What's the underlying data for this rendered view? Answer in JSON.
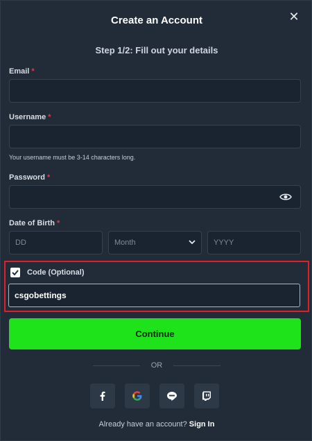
{
  "header": {
    "title": "Create an Account",
    "step": "Step 1/2: Fill out your details"
  },
  "form": {
    "email": {
      "label": "Email",
      "required_mark": "*",
      "value": ""
    },
    "username": {
      "label": "Username",
      "required_mark": "*",
      "value": "",
      "hint": "Your username must be 3-14 characters long."
    },
    "password": {
      "label": "Password",
      "required_mark": "*",
      "value": ""
    },
    "dob": {
      "label": "Date of Birth",
      "required_mark": "*",
      "day_placeholder": "DD",
      "month_placeholder": "Month",
      "year_placeholder": "YYYY"
    },
    "code": {
      "label": "Code (Optional)",
      "checked": true,
      "value": "csgobettings"
    }
  },
  "actions": {
    "continue_label": "Continue",
    "or_label": "OR"
  },
  "social": {
    "buttons": [
      {
        "name": "facebook",
        "icon": "facebook-icon"
      },
      {
        "name": "google",
        "icon": "google-icon"
      },
      {
        "name": "line",
        "icon": "line-icon"
      },
      {
        "name": "twitch",
        "icon": "twitch-icon"
      }
    ]
  },
  "footer": {
    "prompt": "Already have an account?",
    "signin_label": "Sign In"
  },
  "colors": {
    "accent_green": "#1ee21a",
    "required_red": "#e0394a",
    "highlight_red": "#e01f2b",
    "background": "#222c39"
  }
}
